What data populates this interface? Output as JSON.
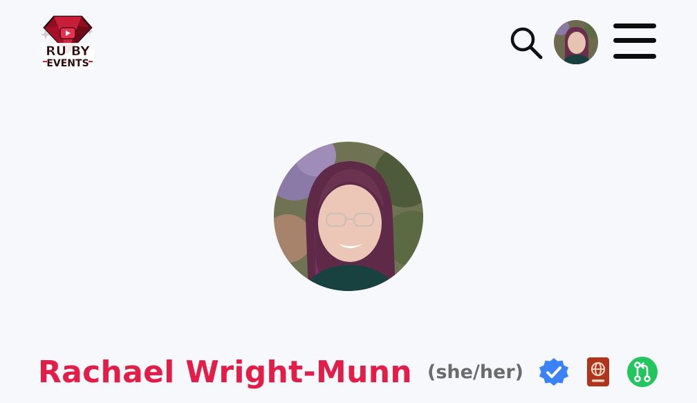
{
  "header": {
    "logo": {
      "line1": "RU BY",
      "line2": "EVENTS",
      "icon": "ruby-gem-logo"
    },
    "search": {
      "icon": "search-icon"
    },
    "user_avatar": {
      "icon": "user-avatar"
    },
    "menu": {
      "icon": "hamburger-menu-icon"
    }
  },
  "profile": {
    "name": "Rachael Wright-Munn",
    "pronouns": "(she/her)",
    "badges": [
      {
        "icon": "verified-badge-icon",
        "color": "#3b82f6"
      },
      {
        "icon": "passport-icon",
        "color": "#b0351c"
      },
      {
        "icon": "git-pull-request-icon",
        "color": "#22c55e"
      }
    ]
  },
  "colors": {
    "accent": "#e11d48",
    "background": "#f7f8fb",
    "pronouns": "#6b6b6b"
  }
}
